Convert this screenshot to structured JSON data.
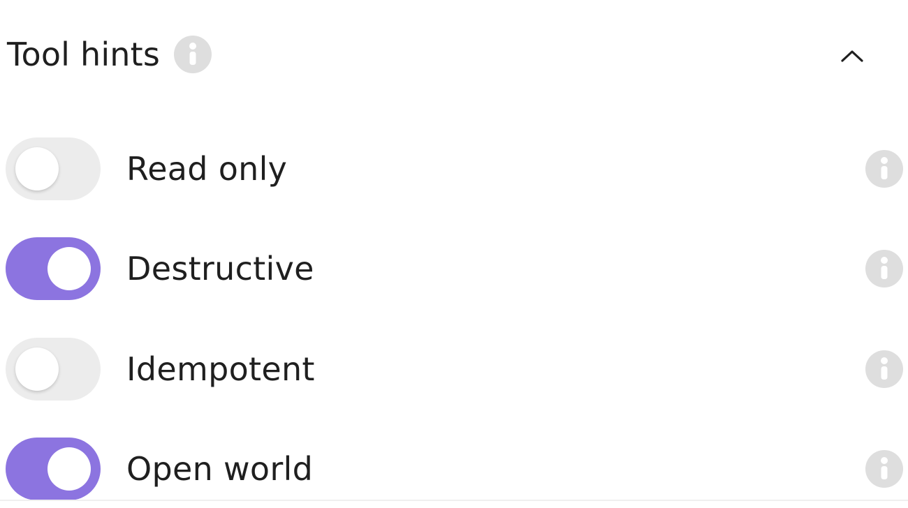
{
  "section": {
    "title": "Tool hints",
    "expanded": true
  },
  "hints": [
    {
      "label": "Read only",
      "enabled": false
    },
    {
      "label": "Destructive",
      "enabled": true
    },
    {
      "label": "Idempotent",
      "enabled": false
    },
    {
      "label": "Open world",
      "enabled": true
    }
  ],
  "icons": {
    "info": "info-icon",
    "collapse": "chevron-up-icon"
  },
  "colors": {
    "toggle_on": "#8c74e0",
    "toggle_off": "#ececec",
    "info_icon": "#dedede",
    "text": "#1f1f1f"
  }
}
